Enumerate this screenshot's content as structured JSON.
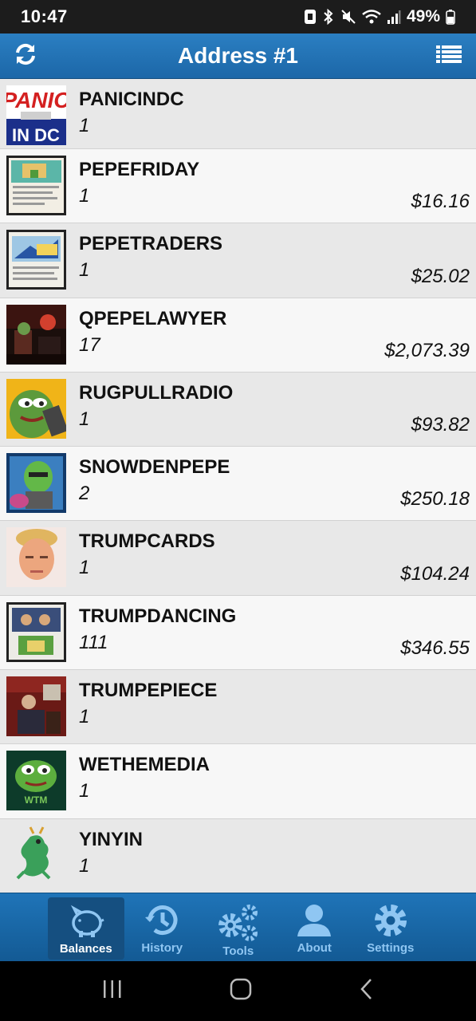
{
  "status_bar": {
    "time": "10:47",
    "battery": "49%"
  },
  "header": {
    "title": "Address #1",
    "left_icon": "refresh-icon",
    "right_icon": "list-icon"
  },
  "assets": [
    {
      "name": "PANICINDC",
      "qty": "1",
      "value": ""
    },
    {
      "name": "PEPEFRIDAY",
      "qty": "1",
      "value": "$16.16"
    },
    {
      "name": "PEPETRADERS",
      "qty": "1",
      "value": "$25.02"
    },
    {
      "name": "QPEPELAWYER",
      "qty": "17",
      "value": "$2,073.39"
    },
    {
      "name": "RUGPULLRADIO",
      "qty": "1",
      "value": "$93.82"
    },
    {
      "name": "SNOWDENPEPE",
      "qty": "2",
      "value": "$250.18"
    },
    {
      "name": "TRUMPCARDS",
      "qty": "1",
      "value": "$104.24"
    },
    {
      "name": "TRUMPDANCING",
      "qty": "111",
      "value": "$346.55"
    },
    {
      "name": "TRUMPEPIECE",
      "qty": "1",
      "value": ""
    },
    {
      "name": "WETHEMEDIA",
      "qty": "1",
      "value": ""
    },
    {
      "name": "YINYIN",
      "qty": "1",
      "value": ""
    }
  ],
  "thumb_text": {
    "panic_top": "PANIC",
    "panic_bottom": "IN DC",
    "wtm": "WTM"
  },
  "tabs": [
    {
      "label": "Balances",
      "icon": "piggy-bank-icon",
      "active": true
    },
    {
      "label": "History",
      "icon": "history-icon",
      "active": false
    },
    {
      "label": "Tools",
      "icon": "gears-icon",
      "active": false
    },
    {
      "label": "About",
      "icon": "user-icon",
      "active": false
    },
    {
      "label": "Settings",
      "icon": "gear-icon",
      "active": false
    }
  ],
  "nav": {
    "recents": "recents-icon",
    "home": "home-icon",
    "back": "back-icon"
  },
  "colors": {
    "header": "#2376bb",
    "tab_active_label": "#ffffff",
    "tab_label": "#8fc6f2"
  }
}
